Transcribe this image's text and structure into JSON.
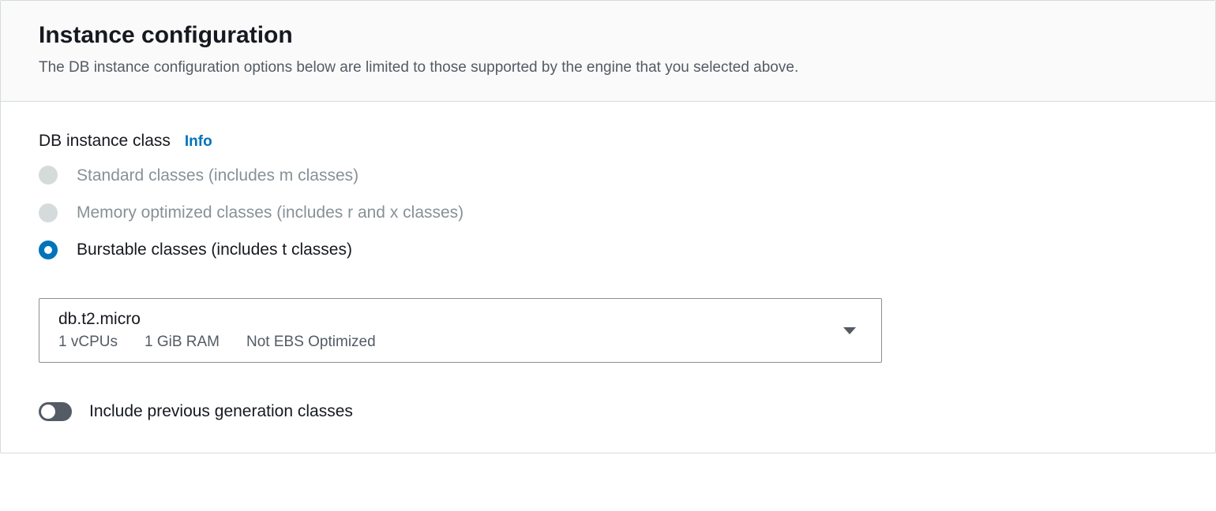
{
  "header": {
    "title": "Instance configuration",
    "description": "The DB instance configuration options below are limited to those supported by the engine that you selected above."
  },
  "field": {
    "label": "DB instance class",
    "info": "Info"
  },
  "radios": {
    "standard": "Standard classes (includes m classes)",
    "memory": "Memory optimized classes (includes r and x classes)",
    "burstable": "Burstable classes (includes t classes)"
  },
  "select": {
    "value": "db.t2.micro",
    "vcpus": "1 vCPUs",
    "ram": "1 GiB RAM",
    "ebs": "Not EBS Optimized"
  },
  "toggle": {
    "label": "Include previous generation classes"
  }
}
